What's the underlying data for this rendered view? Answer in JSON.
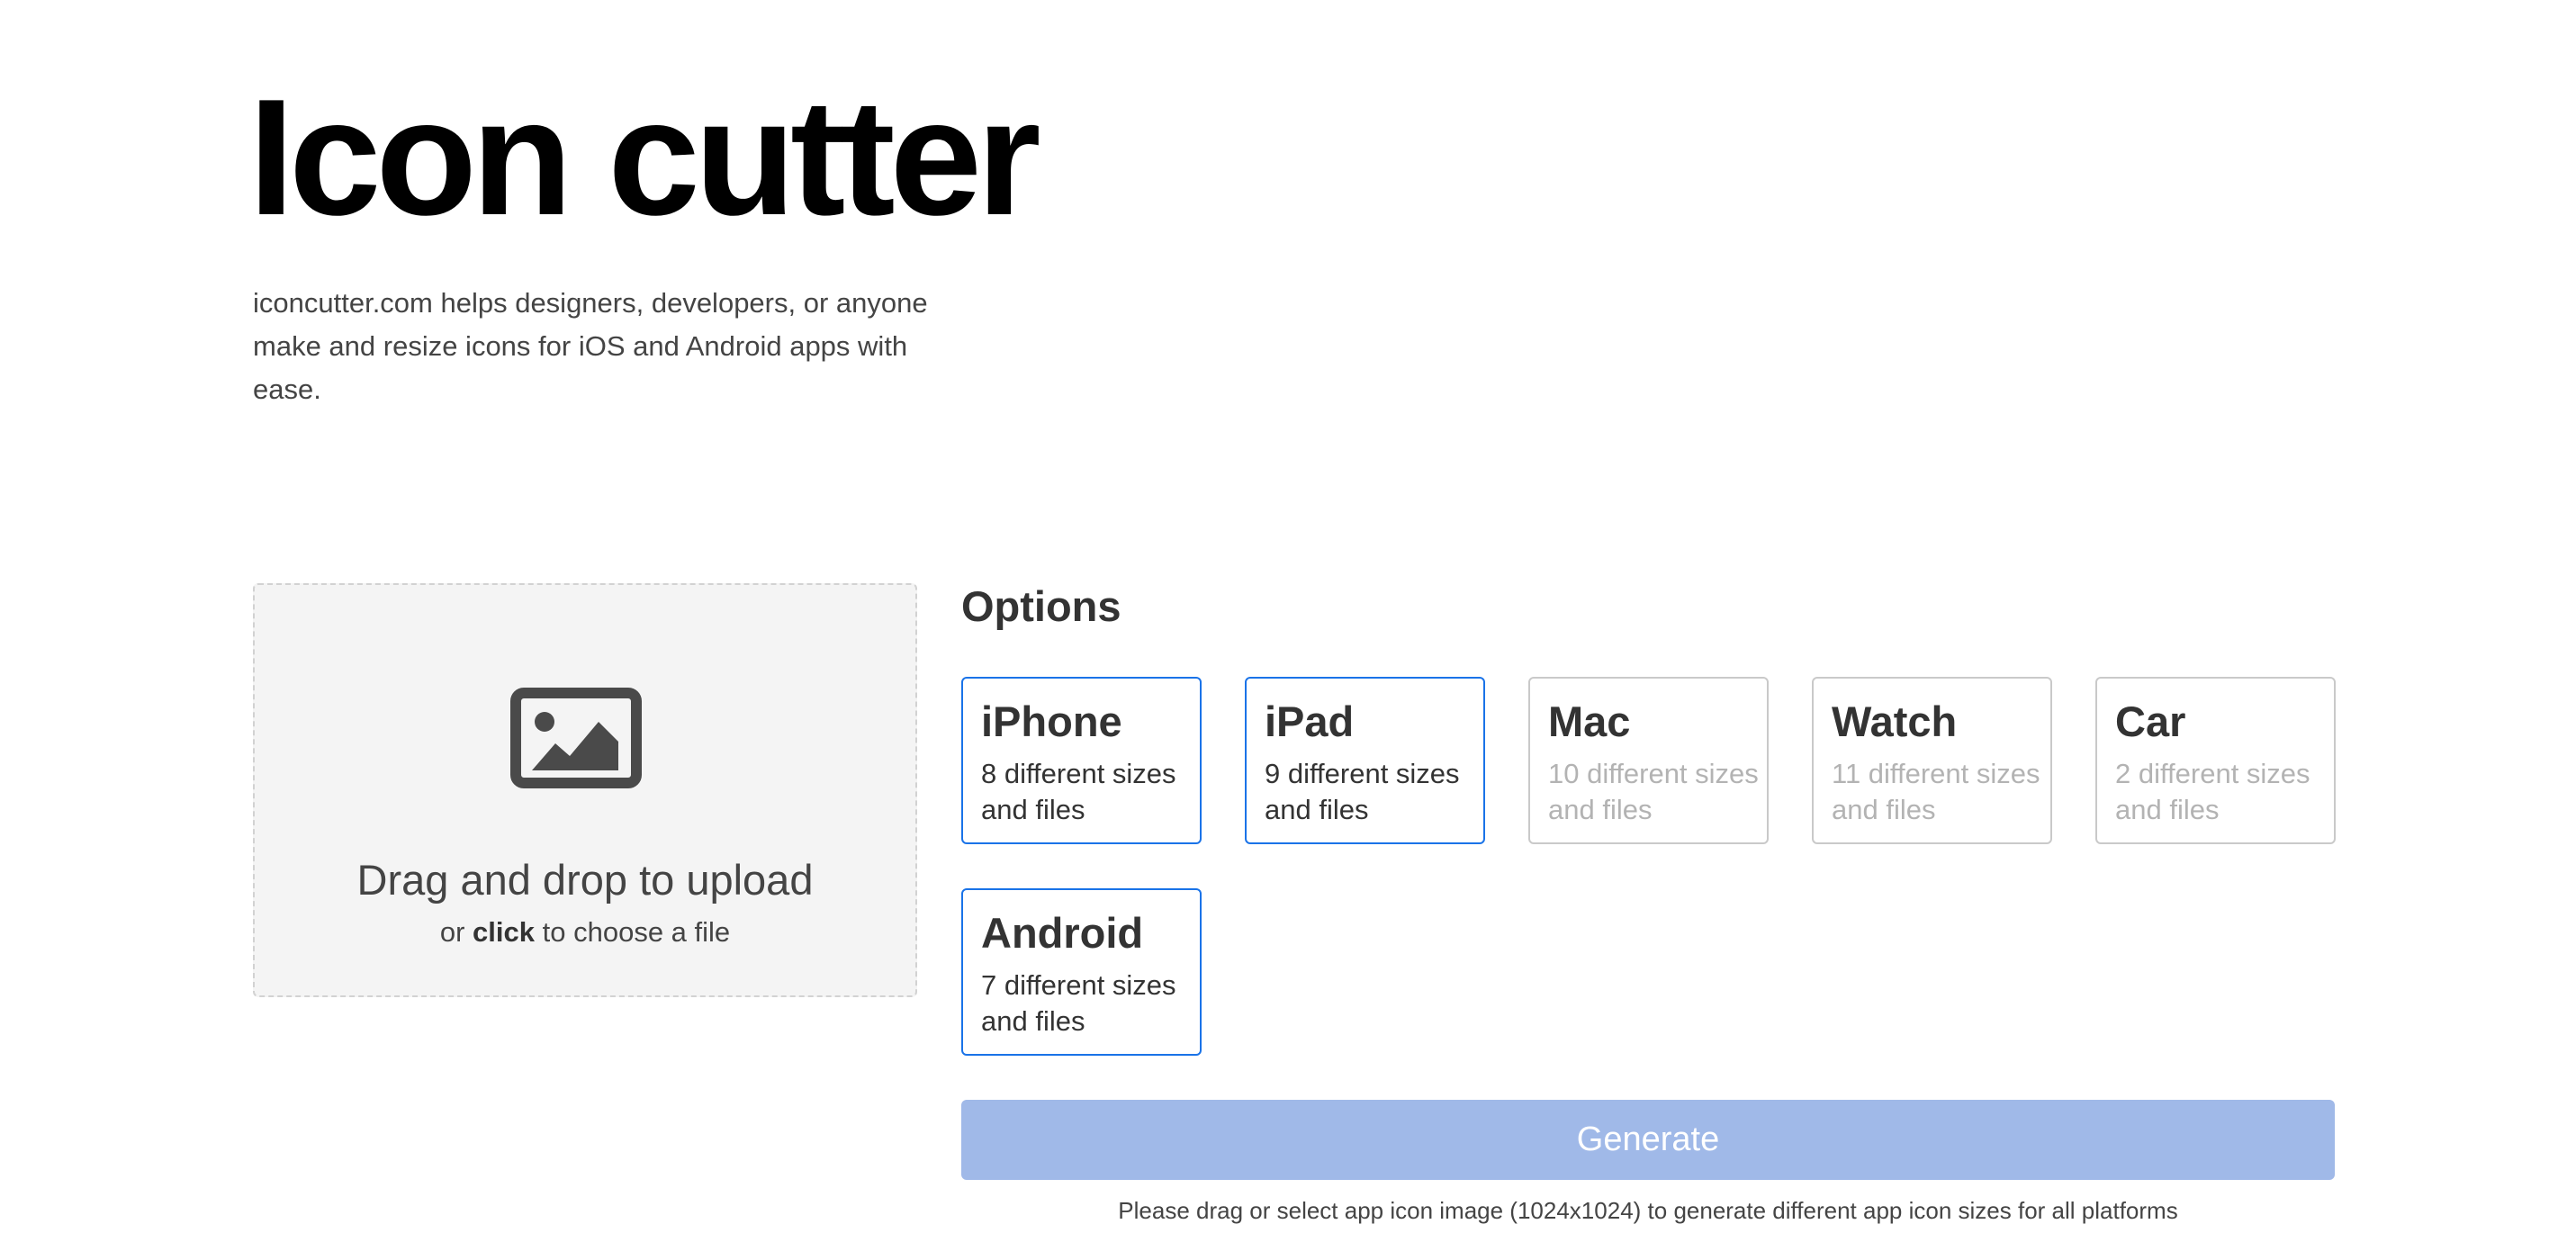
{
  "header": {
    "title": "Icon cutter",
    "description": "iconcutter.com helps designers, developers, or anyone make and resize icons for iOS and Android apps with ease."
  },
  "upload": {
    "icon": "image-icon",
    "title": "Drag and drop to upload",
    "sub_prefix": "or",
    "sub_bold": "click",
    "sub_suffix": "to choose a file"
  },
  "options": {
    "title": "Options",
    "items": [
      {
        "name": "iPhone",
        "detail": "8 different sizes and files",
        "selected": true
      },
      {
        "name": "iPad",
        "detail": "9 different sizes and files",
        "selected": true
      },
      {
        "name": "Mac",
        "detail": "10 different sizes and files",
        "selected": false
      },
      {
        "name": "Watch",
        "detail": "11 different sizes and files",
        "selected": false
      },
      {
        "name": "Car",
        "detail": "2 different sizes and files",
        "selected": false
      },
      {
        "name": "Android",
        "detail": "7 different sizes and files",
        "selected": true
      }
    ]
  },
  "generate": {
    "label": "Generate",
    "disabled": true,
    "hint": "Please drag or select app icon image (1024x1024) to generate different app icon sizes for all platforms"
  },
  "colors": {
    "accent": "#1a73e8",
    "button_disabled": "#a0b9e8",
    "dropzone_bg": "#f4f4f4"
  }
}
